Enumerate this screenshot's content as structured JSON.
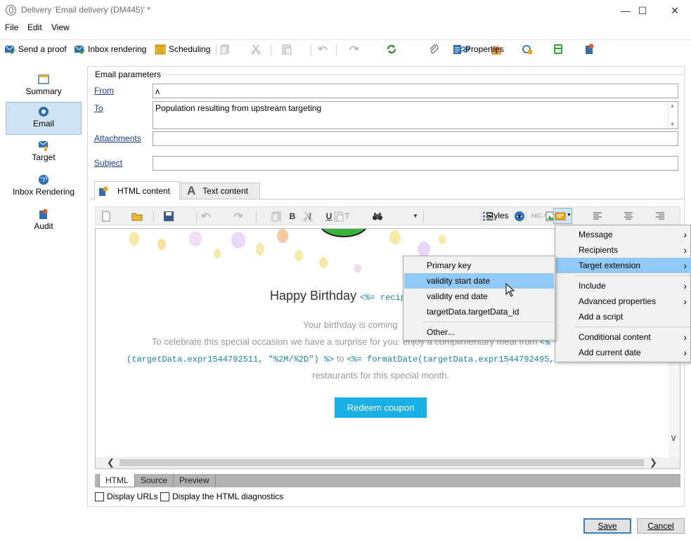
{
  "window": {
    "title": "Delivery 'Email delivery (DM445)' *",
    "minimize": "—",
    "maximize": "☐",
    "close": "✕"
  },
  "menubar": [
    "File",
    "Edit",
    "View"
  ],
  "toolbar": {
    "send_proof": "Send a proof",
    "inbox_rendering": "Inbox rendering",
    "scheduling": "Scheduling",
    "properties": "Properties"
  },
  "sidenav": [
    {
      "label": "Summary",
      "icon": "summary-icon",
      "active": false
    },
    {
      "label": "Email",
      "icon": "email-icon",
      "active": true
    },
    {
      "label": "Target",
      "icon": "target-icon",
      "active": false
    },
    {
      "label": "Inbox Rendering",
      "icon": "globe-icon",
      "active": false
    },
    {
      "label": "Audit",
      "icon": "audit-icon",
      "active": false
    }
  ],
  "email_params": {
    "legend": "Email parameters",
    "from_label": "From",
    "from_value": "ʌ",
    "to_label": "To",
    "to_value": "Population resulting from upstream targeting",
    "attachments_label": "Attachments",
    "attachments_value": "",
    "subject_label": "Subject",
    "subject_value": ""
  },
  "content_tabs": {
    "html": "HTML content",
    "text": "Text content"
  },
  "editor_toolbar": {
    "styles_label": "Styles"
  },
  "editor": {
    "title": "Happy Birthday",
    "title_code": "<%= recip",
    "line1": "Your birthday is coming",
    "line2": "To celebrate this special occasion we have a surprise for you: enjoy a complimentary meal from",
    "line2_code": "<%",
    "line3_code_a": "(targetData.expr1544792511, \"%2M/%2D\") %>",
    "line3_mid": "to",
    "line3_code_b": "<%= formatDate(targetData.expr1544792495, \"",
    "line4": "restaurants for this special month.",
    "button": "Redeem coupon"
  },
  "bottom_tabs": [
    "HTML",
    "Source",
    "Preview"
  ],
  "checkboxes": {
    "display_urls": "Display URLs",
    "html_diagnostics": "Display the HTML diagnostics"
  },
  "dialog": {
    "save": "Save",
    "cancel": "Cancel"
  },
  "context_menu": [
    {
      "label": "Message",
      "submenu": true
    },
    {
      "label": "Recipients",
      "submenu": true
    },
    {
      "label": "Target extension",
      "submenu": true,
      "highlighted": true
    },
    {
      "label": "Include",
      "submenu": true
    },
    {
      "label": "Advanced properties",
      "submenu": true
    },
    {
      "label": "Add a script",
      "submenu": false
    },
    {
      "label": "Conditional content",
      "submenu": true
    },
    {
      "label": "Add current date",
      "submenu": true
    }
  ],
  "target_submenu": [
    {
      "label": "Primary key",
      "highlighted": false
    },
    {
      "label": "validity start date",
      "highlighted": true
    },
    {
      "label": "validity end date",
      "highlighted": false
    },
    {
      "label": "targetData.targetData_id",
      "highlighted": false
    },
    {
      "label": "Other...",
      "highlighted": false
    }
  ],
  "colors": {
    "accent": "#1ab0e6",
    "highlight": "#91c9f7",
    "nav_active": "#cfe3f5",
    "link": "#1a3d8e"
  }
}
